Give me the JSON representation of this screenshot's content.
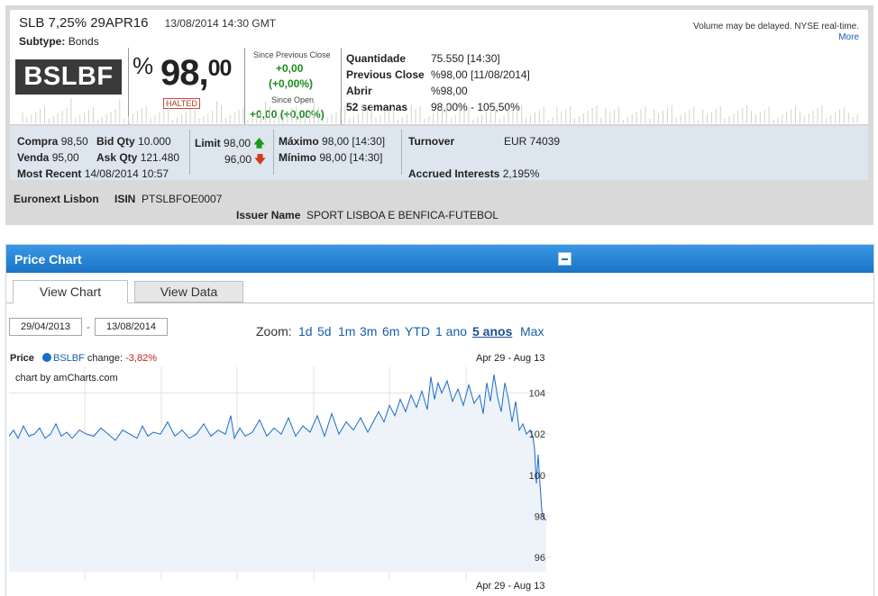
{
  "header": {
    "title": "SLB 7,25% 29APR16",
    "datetime": "13/08/2014 14:30 GMT",
    "subtype_label": "Subtype:",
    "subtype_value": "Bonds",
    "delay_note": "Volume may be delayed. NYSE real-time.",
    "more_link": "More"
  },
  "quote": {
    "ticker": "BSLBF",
    "percent_sign": "%",
    "price_int": "98,",
    "price_dec": "00",
    "status": "HALTED",
    "since_prev_label": "Since Previous Close",
    "since_prev_change": "+0,00",
    "since_prev_pct": "(+0,00%)",
    "since_open_label": "Since Open",
    "since_open_change": "+0,00 (+0,00%)",
    "stats": [
      {
        "label": "Quantidade",
        "value": "75.550 [14:30]"
      },
      {
        "label": "Previous Close",
        "value": "%98,00 [11/08/2014]"
      },
      {
        "label": "Abrir",
        "value": "%98,00"
      },
      {
        "label": "52 semanas",
        "value": "98,00% - 105,50%"
      }
    ]
  },
  "market": {
    "compra_label": "Compra",
    "compra_value": "98,50",
    "bidqty_label": "Bid Qty",
    "bidqty_value": "10.000",
    "venda_label": "Venda",
    "venda_value": "95,00",
    "askqty_label": "Ask Qty",
    "askqty_value": "121.480",
    "recent_label": "Most Recent",
    "recent_value": "14/08/2014 10:57",
    "limit_label": "Limit",
    "limit_up": "98,00",
    "limit_down": "96,00",
    "up_arrow": "🡅",
    "down_arrow": "🡇",
    "max_label": "Máximo",
    "max_value": "98,00 [14:30]",
    "min_label": "Mínimo",
    "min_value": "98,00 [14:30]",
    "turnover_label": "Turnover",
    "turnover_value": "EUR 74039",
    "accrued_label": "Accrued Interests",
    "accrued_value": "2,195%"
  },
  "listing": {
    "exchange": "Euronext Lisbon",
    "isin_label": "ISIN",
    "isin_value": "PTSLBFOE0007",
    "issuer_label": "Issuer Name",
    "issuer_value": "SPORT LISBOA E BENFICA-FUTEBOL"
  },
  "panel": {
    "title": "Price Chart",
    "tabs": [
      "View Chart",
      "View Data"
    ],
    "date_from": "29/04/2013",
    "date_sep": "-",
    "date_to": "13/08/2014",
    "zoom_label": "Zoom:",
    "zoom_options": [
      "1d",
      "5d",
      "1m",
      "3m",
      "6m",
      "YTD",
      "1 ano",
      "5 anos",
      "Max"
    ],
    "zoom_selected": "5 anos"
  },
  "chart_data": {
    "type": "area",
    "legend_title": "Price",
    "series_name": "BSLBF",
    "change_label": "change:",
    "change_value": "-3,82%",
    "watermark": "chart by amCharts.com",
    "range_label": "Apr 29 - Aug 13",
    "ylim": [
      95.3,
      105.3
    ],
    "yticks": [
      96,
      98,
      100,
      102,
      104
    ],
    "ytick_labels": [
      "96",
      "98",
      "100",
      "102",
      "104"
    ],
    "line_color": "#1c6cc9",
    "fill_color": "#edf3f8",
    "x": [
      0,
      5,
      10,
      16,
      22,
      28,
      34,
      40,
      46,
      52,
      58,
      64,
      70,
      78,
      86,
      94,
      102,
      110,
      118,
      126,
      134,
      142,
      148,
      154,
      160,
      168,
      176,
      184,
      192,
      200,
      208,
      216,
      224,
      232,
      240,
      246,
      250,
      256,
      262,
      270,
      278,
      286,
      294,
      302,
      310,
      318,
      326,
      334,
      342,
      350,
      358,
      366,
      374,
      382,
      390,
      398,
      404,
      410,
      416,
      422,
      428,
      434,
      440,
      446,
      452,
      458,
      464,
      468,
      472,
      476,
      480,
      486,
      492,
      498,
      504,
      510,
      516,
      522,
      526,
      530,
      534,
      538,
      542,
      546,
      550,
      554,
      558,
      562,
      566,
      570,
      574,
      578,
      581,
      583,
      585,
      587,
      589,
      591,
      593,
      596
    ],
    "values": [
      101.9,
      102.2,
      101.8,
      102.4,
      101.9,
      102.0,
      102.3,
      101.8,
      102.0,
      102.5,
      101.9,
      102.1,
      101.8,
      102.2,
      102.0,
      101.9,
      102.3,
      102.0,
      101.7,
      102.2,
      102.0,
      101.8,
      102.4,
      101.9,
      102.1,
      102.0,
      102.6,
      101.9,
      102.2,
      101.8,
      102.0,
      102.5,
      101.9,
      102.2,
      102.0,
      102.9,
      101.8,
      102.3,
      101.9,
      102.1,
      102.7,
      101.9,
      102.3,
      102.0,
      102.8,
      101.9,
      102.4,
      102.1,
      102.9,
      101.9,
      103.0,
      102.0,
      102.6,
      102.2,
      102.8,
      102.1,
      102.6,
      103.1,
      102.6,
      103.4,
      102.9,
      103.7,
      103.1,
      103.9,
      103.3,
      104.1,
      103.2,
      104.8,
      103.7,
      104.5,
      104.0,
      104.6,
      103.6,
      104.2,
      103.4,
      104.4,
      103.5,
      103.9,
      103.0,
      104.5,
      103.6,
      104.9,
      103.8,
      103.1,
      104.5,
      103.7,
      102.6,
      103.6,
      102.2,
      102.5,
      102.0,
      102.2,
      101.9,
      101.3,
      99.6,
      101.0,
      99.6,
      98.3,
      97.9,
      97.8
    ]
  }
}
